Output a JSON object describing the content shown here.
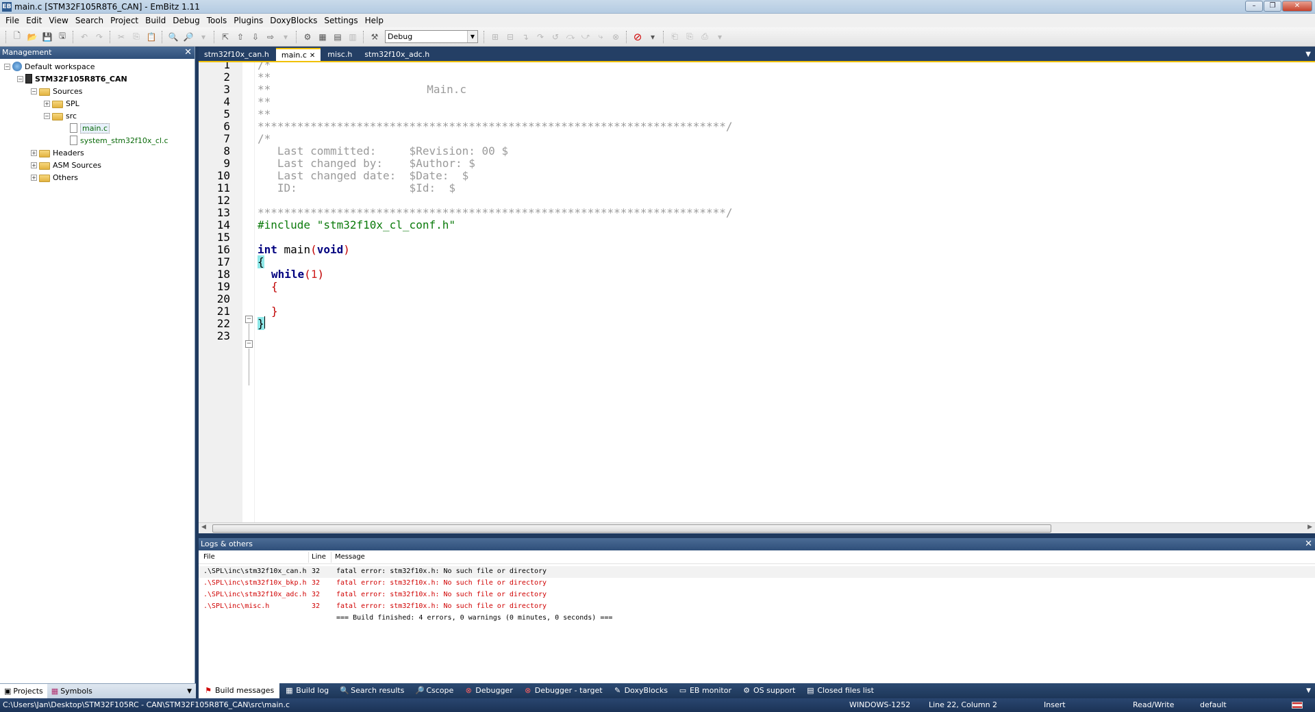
{
  "window": {
    "title": "main.c [STM32F105R8T6_CAN] - EmBitz 1.11",
    "app_icon": "EB"
  },
  "menu": [
    "File",
    "Edit",
    "View",
    "Search",
    "Project",
    "Build",
    "Debug",
    "Tools",
    "Plugins",
    "DoxyBlocks",
    "Settings",
    "Help"
  ],
  "toolbar": {
    "build_target": "Debug"
  },
  "management": {
    "title": "Management",
    "tree": [
      {
        "label": "Default workspace",
        "depth": 0,
        "icon": "workspace-icon",
        "toggle": "-"
      },
      {
        "label": "STM32F105R8T6_CAN",
        "depth": 1,
        "icon": "project-icon",
        "toggle": "-",
        "bold": true
      },
      {
        "label": "Sources",
        "depth": 2,
        "icon": "folder-icon",
        "toggle": "-"
      },
      {
        "label": "SPL",
        "depth": 3,
        "icon": "folder-icon",
        "toggle": "+"
      },
      {
        "label": "src",
        "depth": 3,
        "icon": "folder-icon",
        "toggle": "-"
      },
      {
        "label": "main.c",
        "depth": 4,
        "icon": "file-icon",
        "toggle": "",
        "green": true,
        "selected": true
      },
      {
        "label": "system_stm32f10x_cl.c",
        "depth": 4,
        "icon": "file-icon",
        "toggle": "",
        "green": true
      },
      {
        "label": "Headers",
        "depth": 2,
        "icon": "folder-icon",
        "toggle": "+"
      },
      {
        "label": "ASM Sources",
        "depth": 2,
        "icon": "folder-icon",
        "toggle": "+"
      },
      {
        "label": "Others",
        "depth": 2,
        "icon": "folder-icon",
        "toggle": "+"
      }
    ],
    "tabs": [
      "Projects",
      "Symbols"
    ]
  },
  "editor": {
    "tabs": [
      {
        "label": "stm32f10x_can.h",
        "active": false
      },
      {
        "label": "main.c",
        "active": true
      },
      {
        "label": "misc.h",
        "active": false
      },
      {
        "label": "stm32f10x_adc.h",
        "active": false
      }
    ],
    "lines": [
      "1",
      "2",
      "3",
      "4",
      "5",
      "6",
      "7",
      "8",
      "9",
      "10",
      "11",
      "12",
      "13",
      "14",
      "15",
      "16",
      "17",
      "18",
      "19",
      "20",
      "21",
      "22",
      "23"
    ],
    "code": {
      "l1": "/*",
      "l2": "**",
      "l3a": "**",
      "l3b": "Main.c",
      "l4": "**",
      "l5": "**",
      "l6": "***********************************************************************/",
      "l7": "/*",
      "l8": "   Last committed:     $Revision: 00 $",
      "l9": "   Last changed by:    $Author: $",
      "l10": "   Last changed date:  $Date:  $",
      "l11": "   ID:                 $Id:  $",
      "l13": "***********************************************************************/",
      "l14": "#include \"stm32f10x_cl_conf.h\"",
      "l16_kw1": "int",
      "l16_fn": " main",
      "l16_p1": "(",
      "l16_kw2": "void",
      "l16_p2": ")",
      "l17": "{",
      "l18_kw": "while",
      "l18_p1": "(",
      "l18_num": "1",
      "l18_p2": ")",
      "l19": "{",
      "l21": "}",
      "l22": "}"
    }
  },
  "logs": {
    "title": "Logs & others",
    "columns": {
      "file": "File",
      "line": "Line",
      "message": "Message"
    },
    "rows": [
      {
        "file": ".\\SPL\\inc\\stm32f10x_can.h",
        "line": "32",
        "message": "fatal error: stm32f10x.h: No such file or directory"
      },
      {
        "file": ".\\SPL\\inc\\stm32f10x_bkp.h",
        "line": "32",
        "message": "fatal error: stm32f10x.h: No such file or directory"
      },
      {
        "file": ".\\SPL\\inc\\stm32f10x_adc.h",
        "line": "32",
        "message": "fatal error: stm32f10x.h: No such file or directory"
      },
      {
        "file": ".\\SPL\\inc\\misc.h",
        "line": "32",
        "message": "fatal error: stm32f10x.h: No such file or directory"
      },
      {
        "file": "",
        "line": "",
        "message": "=== Build finished: 4 errors, 0 warnings (0 minutes, 0 seconds) ==="
      }
    ],
    "tabs": [
      "Build messages",
      "Build log",
      "Search results",
      "Cscope",
      "Debugger",
      "Debugger - target",
      "DoxyBlocks",
      "EB monitor",
      "OS support",
      "Closed files list"
    ]
  },
  "status": {
    "path": "C:\\Users\\Jan\\Desktop\\STM32F105RC - CAN\\STM32F105R8T6_CAN\\src\\main.c",
    "encoding": "WINDOWS-1252",
    "position": "Line 22, Column 2",
    "mode": "Insert",
    "access": "Read/Write",
    "lang": "default"
  },
  "colors": {
    "accent": "#f0c000",
    "panel_header": "#2f4f7a",
    "error": "#d00000"
  }
}
